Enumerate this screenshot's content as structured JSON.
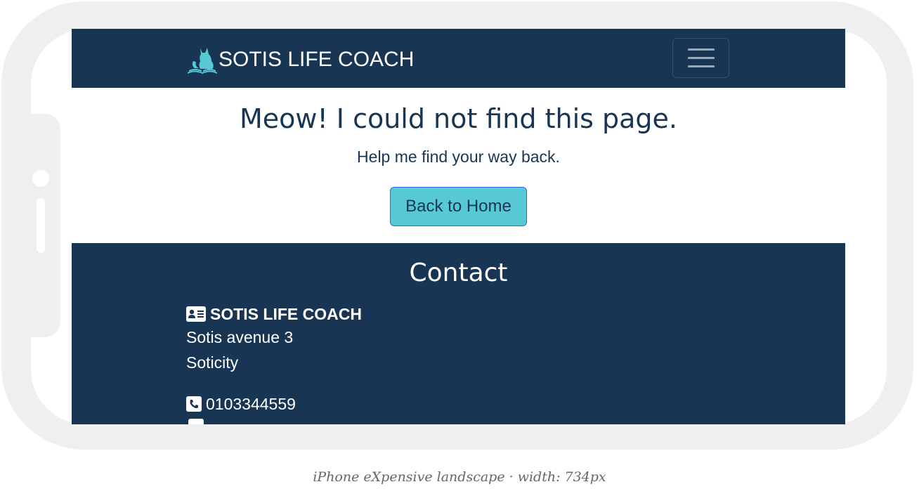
{
  "navbar": {
    "brand": "SOTIS LIFE COACH",
    "logo_icon": "cat-on-book-icon",
    "toggler_icon": "hamburger-menu-icon"
  },
  "error": {
    "title": "Meow! I could not find this page.",
    "subtitle": "Help me find your way back.",
    "button_label": "Back to Home"
  },
  "footer": {
    "title": "Contact",
    "company": "SOTIS LIFE COACH",
    "address_line1": "Sotis avenue 3",
    "address_line2": "Soticity",
    "phone": "0103344559",
    "email": ""
  },
  "caption": "iPhone eXpensive landscape · width: 734px",
  "colors": {
    "navy": "#183653",
    "accent": "#56c9d4",
    "frame": "#efefef"
  }
}
